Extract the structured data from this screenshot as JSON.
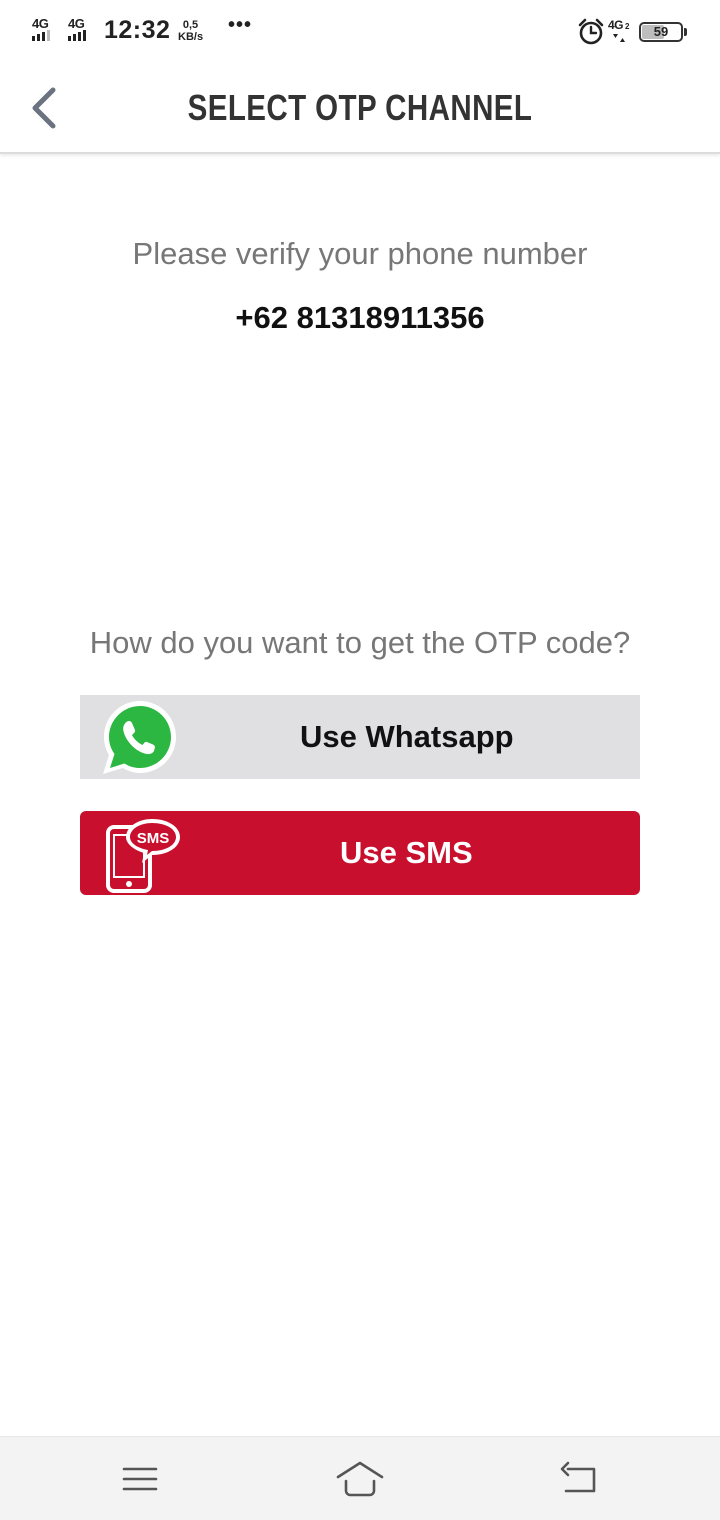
{
  "status_bar": {
    "network_1": "4G",
    "network_2": "4G",
    "time": "12:32",
    "speed_value": "0,5",
    "speed_unit": "KB/s",
    "more": "•••",
    "network_3": "4G",
    "sim_index": "2",
    "battery": "59",
    "battery_level": 0.59
  },
  "header": {
    "title": "SELECT OTP CHANNEL",
    "back_icon": "chevron-left-icon"
  },
  "content": {
    "verify_prompt": "Please verify your phone number",
    "phone_number": "+62 81318911356",
    "channel_question": "How do you want to get the OTP code?"
  },
  "buttons": {
    "whatsapp_label": "Use Whatsapp",
    "whatsapp_icon": "whatsapp-icon",
    "sms_label": "Use SMS",
    "sms_icon_text": "SMS",
    "sms_icon": "sms-phone-icon"
  },
  "nav": {
    "menu_icon": "menu-icon",
    "home_icon": "home-icon",
    "back_icon": "back-icon"
  },
  "colors": {
    "sms_button": "#c8102e",
    "whatsapp_button": "#e0e0e2",
    "whatsapp_green": "#25d366",
    "title_text": "#333333",
    "muted_text": "#777777"
  }
}
